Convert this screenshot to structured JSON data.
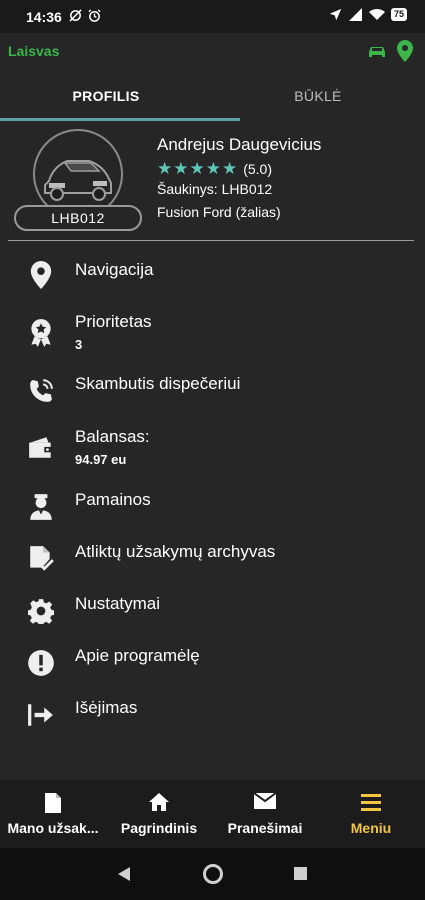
{
  "status_bar": {
    "time": "14:36",
    "battery": "75"
  },
  "app_bar": {
    "status": "Laisvas",
    "status_color": "#3cb54a",
    "icons": [
      "car-icon",
      "location-pin-icon"
    ]
  },
  "tabs": [
    {
      "label": "PROFILIS",
      "active": true
    },
    {
      "label": "BŪKLĖ",
      "active": false
    }
  ],
  "profile": {
    "name": "Andrejus Daugevicius",
    "stars": "★★★★★",
    "rating": "(5.0)",
    "callsign": "Šaukinys: LHB012",
    "car": "Fusion Ford (žalias)",
    "plate": "LHB012"
  },
  "menu": {
    "items": [
      {
        "label": "Navigacija",
        "icon": "location-pin-icon"
      },
      {
        "label": "Prioritetas",
        "sub": "3",
        "icon": "badge-icon"
      },
      {
        "label": "Skambutis dispečeriui",
        "icon": "phone-call-icon"
      },
      {
        "label": "Balansas:",
        "sub": "94.97 eu",
        "icon": "wallet-icon"
      },
      {
        "label": "Pamainos",
        "icon": "driver-icon"
      },
      {
        "label": "Atliktų užsakymų archyvas",
        "icon": "document-check-icon"
      },
      {
        "label": "Nustatymai",
        "icon": "gear-icon"
      },
      {
        "label": "Apie programėlę",
        "icon": "info-alert-icon"
      },
      {
        "label": "Išėjimas",
        "icon": "exit-icon"
      }
    ]
  },
  "bottom_nav": {
    "items": [
      {
        "label": "Mano užsak...",
        "icon": "document-icon"
      },
      {
        "label": "Pagrindinis",
        "icon": "home-icon"
      },
      {
        "label": "Pranešimai",
        "icon": "mail-icon"
      },
      {
        "label": "Meniu",
        "icon": "menu-icon",
        "active": true
      }
    ],
    "active_color": "#f4c542"
  }
}
